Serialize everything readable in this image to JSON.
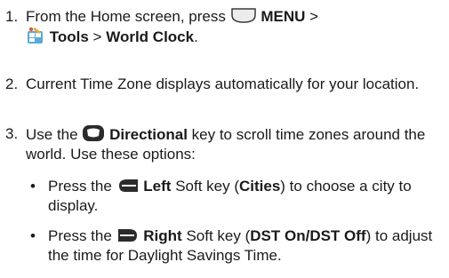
{
  "steps": [
    {
      "number": "1.",
      "before_menu": "From the Home screen, press",
      "menu_label": "MENU",
      "sep1": ">",
      "tools_label": "Tools",
      "sep2": ">",
      "world_clock_label": "World Clock",
      "end": ".",
      "icons": [
        "menu-key-icon",
        "tools-icon"
      ]
    },
    {
      "number": "2.",
      "text": "Current Time Zone displays automatically for your location."
    },
    {
      "number": "3.",
      "before_key": "Use the",
      "directional_label": "Directional",
      "after_key": "key to scroll time zones around the world. Use these options:",
      "icons": [
        "directional-key-icon"
      ]
    }
  ],
  "bullets": [
    {
      "marker": "•",
      "before_key": "Press the",
      "key_label": "Left",
      "mid": "Soft key (",
      "option_label": "Cities",
      "after": ") to choose a city to display.",
      "icon": "left-soft-key-icon"
    },
    {
      "marker": "•",
      "before_key": "Press the",
      "key_label": "Right",
      "mid": "Soft key (",
      "option_label": "DST On/DST Off",
      "after": ") to adjust the time for Daylight Savings Time.",
      "icon": "right-soft-key-icon"
    }
  ],
  "colors": {
    "text": "#1a1a1a",
    "key_dark": "#2b2b2b",
    "key_light": "#e6e6e6"
  }
}
